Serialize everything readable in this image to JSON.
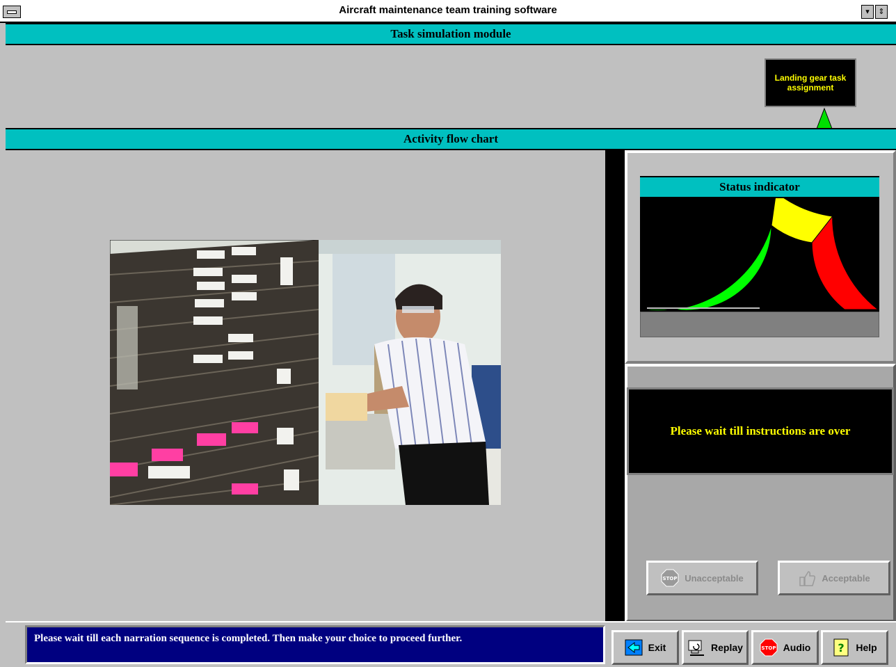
{
  "window": {
    "title": "Aircraft maintenance team training software"
  },
  "header": {
    "module_title": "Task simulation module"
  },
  "task_box": {
    "label": "Landing gear task assignment"
  },
  "flowchart": {
    "title": "Activity flow chart"
  },
  "status": {
    "title": "Status indicator",
    "colors": {
      "green": "#00ff00",
      "yellow": "#ffff00",
      "red": "#ff0000"
    }
  },
  "instructions": {
    "message": "Please wait till instructions are over"
  },
  "decision": {
    "unacceptable_label": "Unacceptable",
    "acceptable_label": "Acceptable"
  },
  "footer": {
    "narration": "Please wait till each narration sequence is completed. Then make your choice to proceed further.",
    "exit_label": "Exit",
    "replay_label": "Replay",
    "audio_label": "Audio",
    "help_label": "Help"
  },
  "icons": [
    "system-menu-icon",
    "minimize-icon",
    "restore-icon",
    "exit-icon",
    "replay-icon",
    "stop-icon",
    "help-icon"
  ]
}
